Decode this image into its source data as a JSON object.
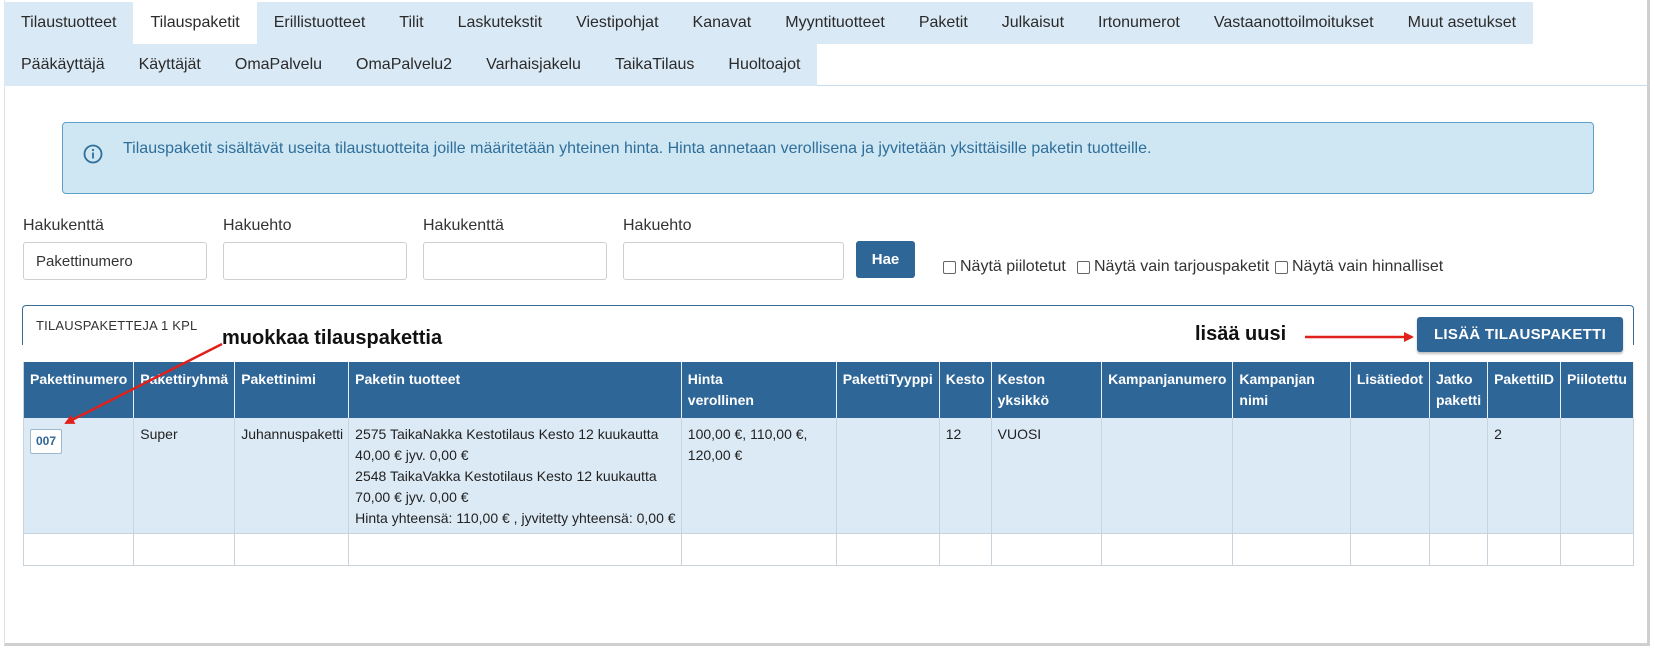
{
  "tabs": {
    "row1": [
      "Tilaustuotteet",
      "Tilauspaketit",
      "Erillistuotteet",
      "Tilit",
      "Laskutekstit",
      "Viestipohjat",
      "Kanavat",
      "Myyntituotteet",
      "Paketit",
      "Julkaisut",
      "Irtonumerot",
      "Vastaanottoilmoitukset",
      "Muut asetukset"
    ],
    "row2": [
      "Pääkäyttäjä",
      "Käyttäjät",
      "OmaPalvelu",
      "OmaPalvelu2",
      "Varhaisjakelu",
      "TaikaTilaus",
      "Huoltoajot"
    ],
    "active": "Tilauspaketit"
  },
  "info": {
    "icon": "info-circle-icon",
    "text": "Tilauspaketit sisältävät useita tilaustuotteita joille määritetään yhteinen hinta. Hinta annetaan verollisena ja jyvitetään yksittäisille paketin tuotteille."
  },
  "search": {
    "field1_label": "Hakukenttä",
    "field1_value": "Pakettinumero",
    "cond1_label": "Hakuehto",
    "cond1_value": "",
    "field2_label": "Hakukenttä",
    "field2_value": "",
    "cond2_label": "Hakuehto",
    "cond2_value": "",
    "search_button": "Hae",
    "checkbox_hidden": "Näytä piilotetut",
    "checkbox_offers": "Näytä vain tarjouspaketit",
    "checkbox_priced": "Näytä vain hinnalliset"
  },
  "panel": {
    "title": "TILAUSPAKETTEJA 1 KPL",
    "add_button": "LISÄÄ TILAUSPAKETTI"
  },
  "table": {
    "headers": {
      "h0": "Pakettinumero",
      "h1": "Pakettiryhmä",
      "h2": "Pakettinimi",
      "h3": "Paketin tuotteet",
      "h4a": "Hinta",
      "h4b": "verollinen",
      "h5": "PakettiTyyppi",
      "h6": "Kesto",
      "h7": "Keston yksikkö",
      "h8": "Kampanjanumero",
      "h9": "Kampanjan nimi",
      "h10": "Lisätiedot",
      "h11a": "Jatko",
      "h11b": "paketti",
      "h12": "PakettiID",
      "h13": "Piilotettu"
    },
    "row": {
      "number": "007",
      "group": "Super",
      "name": "Juhannuspaketti",
      "products": {
        "l1": "2575 TaikaNakka Kestotilaus Kesto 12 kuukautta",
        "l2": "40,00 € jyv. 0,00 €",
        "l3": "2548 TaikaVakka Kestotilaus Kesto 12 kuukautta",
        "l4": "70,00 € jyv. 0,00 €",
        "l5": "Hinta yhteensä: 110,00 € , jyvitetty yhteensä: 0,00 €"
      },
      "price": {
        "l1": "100,00 €, 110,00 €,",
        "l2": "120,00 €"
      },
      "type": "",
      "duration": "12",
      "duration_unit": "VUOSI",
      "campaign_number": "",
      "campaign_name": "",
      "extra": "",
      "continuation": "",
      "package_id": "2",
      "hidden": ""
    }
  },
  "annotations": {
    "edit": "muokkaa tilauspakettia",
    "add": "lisää uusi",
    "arrow_color": "#e0201b"
  }
}
